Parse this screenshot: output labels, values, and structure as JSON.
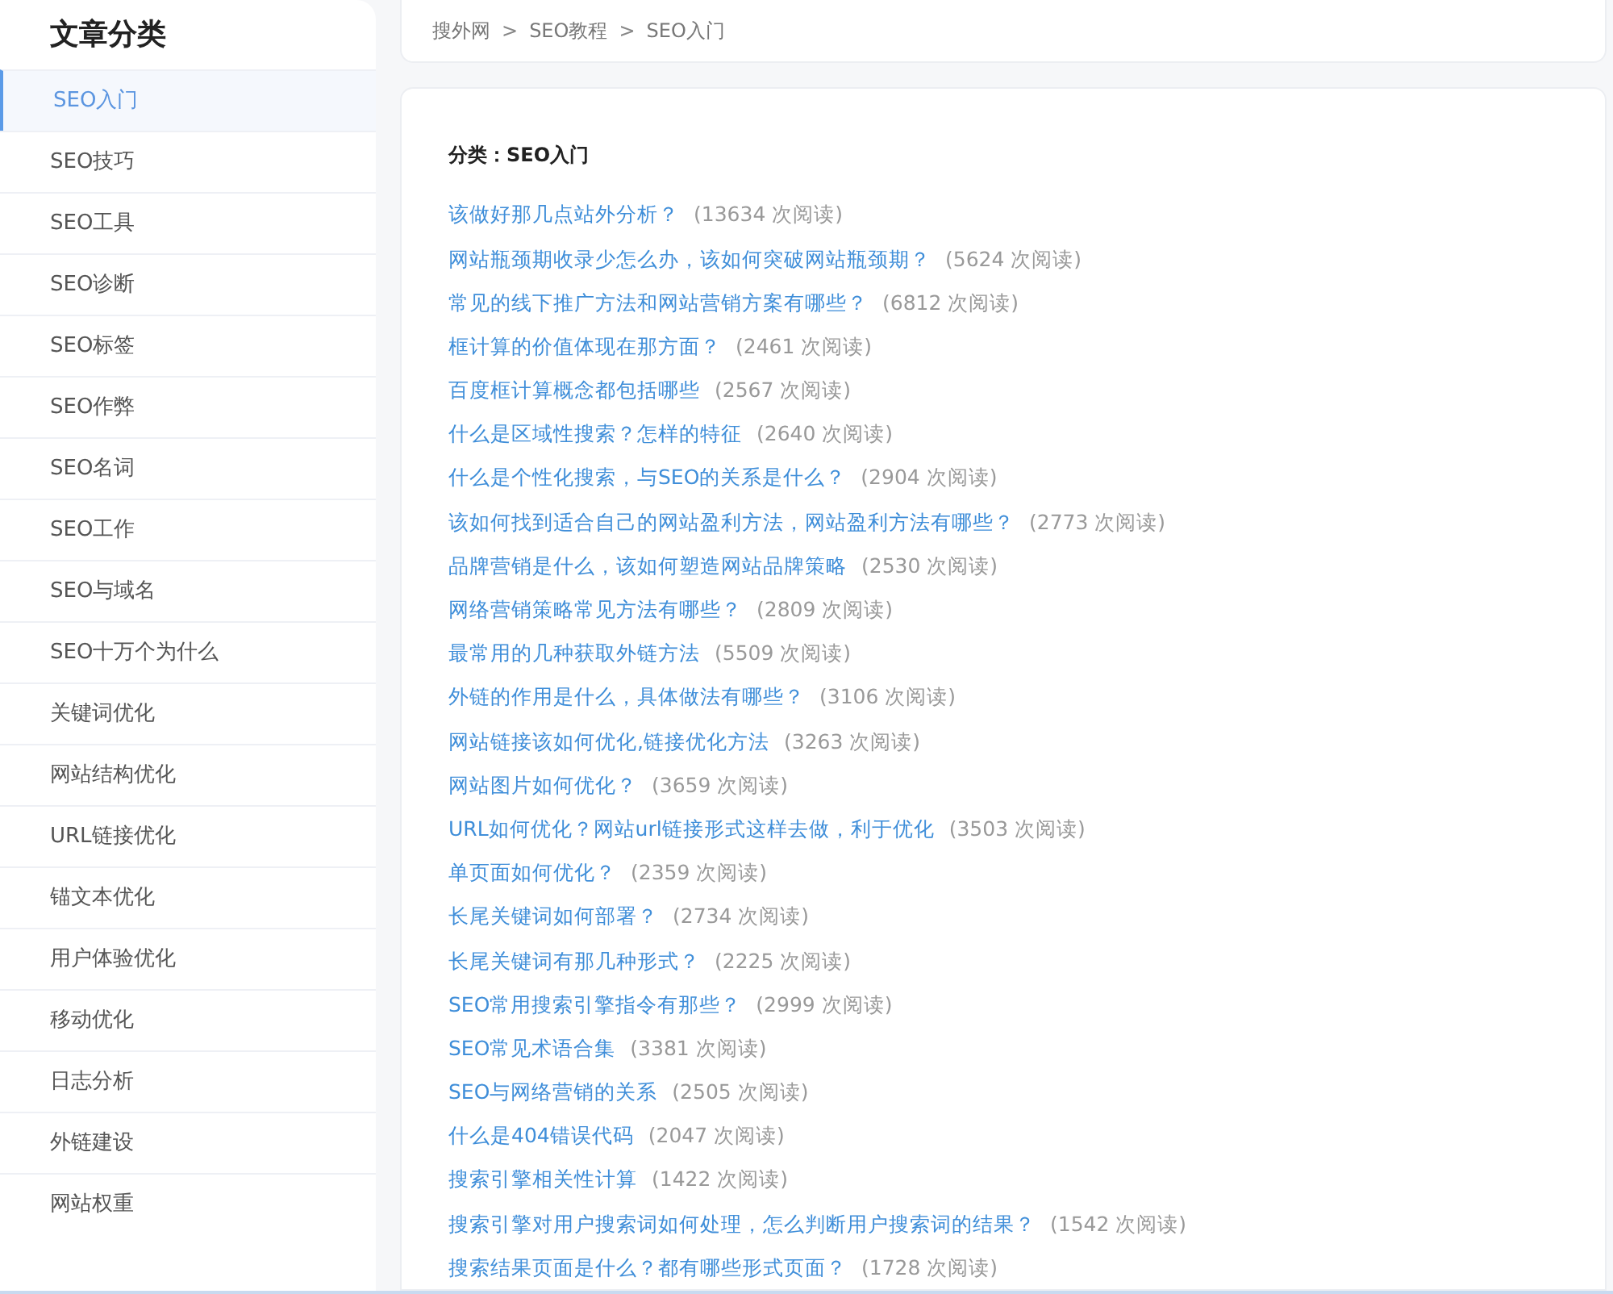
{
  "sidebar": {
    "title": "文章分类",
    "items": [
      {
        "label": "SEO入门",
        "selected": true
      },
      {
        "label": "SEO技巧",
        "selected": false
      },
      {
        "label": "SEO工具",
        "selected": false
      },
      {
        "label": "SEO诊断",
        "selected": false
      },
      {
        "label": "SEO标签",
        "selected": false
      },
      {
        "label": "SEO作弊",
        "selected": false
      },
      {
        "label": "SEO名词",
        "selected": false
      },
      {
        "label": "SEO工作",
        "selected": false
      },
      {
        "label": "SEO与域名",
        "selected": false
      },
      {
        "label": "SEO十万个为什么",
        "selected": false
      },
      {
        "label": "关键词优化",
        "selected": false
      },
      {
        "label": "网站结构优化",
        "selected": false
      },
      {
        "label": "URL链接优化",
        "selected": false
      },
      {
        "label": "锚文本优化",
        "selected": false
      },
      {
        "label": "用户体验优化",
        "selected": false
      },
      {
        "label": "移动优化",
        "selected": false
      },
      {
        "label": "日志分析",
        "selected": false
      },
      {
        "label": "外链建设",
        "selected": false
      },
      {
        "label": "网站权重",
        "selected": false
      }
    ]
  },
  "breadcrumb": {
    "separator": ">",
    "items": [
      "搜外网",
      "SEO教程",
      "SEO入门"
    ]
  },
  "category": {
    "heading": "分类：SEO入门",
    "articles": [
      {
        "title": "该做好那几点站外分析？",
        "views": "(13634 次阅读)"
      },
      {
        "title": "网站瓶颈期收录少怎么办，该如何突破网站瓶颈期？",
        "views": "(5624 次阅读)"
      },
      {
        "title": "常见的线下推广方法和网站营销方案有哪些？",
        "views": "(6812 次阅读)"
      },
      {
        "title": "框计算的价值体现在那方面？",
        "views": "(2461 次阅读)"
      },
      {
        "title": "百度框计算概念都包括哪些",
        "views": "(2567 次阅读)"
      },
      {
        "title": "什么是区域性搜索？怎样的特征",
        "views": "(2640 次阅读)"
      },
      {
        "title": "什么是个性化搜索，与SEO的关系是什么？",
        "views": "(2904 次阅读)"
      },
      {
        "title": "该如何找到适合自己的网站盈利方法，网站盈利方法有哪些？",
        "views": "(2773 次阅读)"
      },
      {
        "title": "品牌营销是什么，该如何塑造网站品牌策略",
        "views": "(2530 次阅读)"
      },
      {
        "title": "网络营销策略常见方法有哪些？",
        "views": "(2809 次阅读)"
      },
      {
        "title": "最常用的几种获取外链方法",
        "views": "(5509 次阅读)"
      },
      {
        "title": "外链的作用是什么，具体做法有哪些？",
        "views": "(3106 次阅读)"
      },
      {
        "title": "网站链接该如何优化,链接优化方法",
        "views": "(3263 次阅读)"
      },
      {
        "title": "网站图片如何优化？",
        "views": "(3659 次阅读)"
      },
      {
        "title": "URL如何优化？网站url链接形式这样去做，利于优化",
        "views": "(3503 次阅读)"
      },
      {
        "title": "单页面如何优化？",
        "views": "(2359 次阅读)"
      },
      {
        "title": "长尾关键词如何部署？",
        "views": "(2734 次阅读)"
      },
      {
        "title": "长尾关键词有那几种形式？",
        "views": "(2225 次阅读)"
      },
      {
        "title": "SEO常用搜索引擎指令有那些？",
        "views": "(2999 次阅读)"
      },
      {
        "title": "SEO常见术语合集",
        "views": "(3381 次阅读)"
      },
      {
        "title": "SEO与网络营销的关系",
        "views": "(2505 次阅读)"
      },
      {
        "title": "什么是404错误代码",
        "views": "(2047 次阅读)"
      },
      {
        "title": "搜索引擎相关性计算",
        "views": "(1422 次阅读)"
      },
      {
        "title": "搜索引擎对用户搜索词如何处理，怎么判断用户搜索词的结果？",
        "views": "(1542 次阅读)"
      },
      {
        "title": "搜索结果页面是什么？都有哪些形式页面？",
        "views": "(1728 次阅读)"
      }
    ]
  }
}
